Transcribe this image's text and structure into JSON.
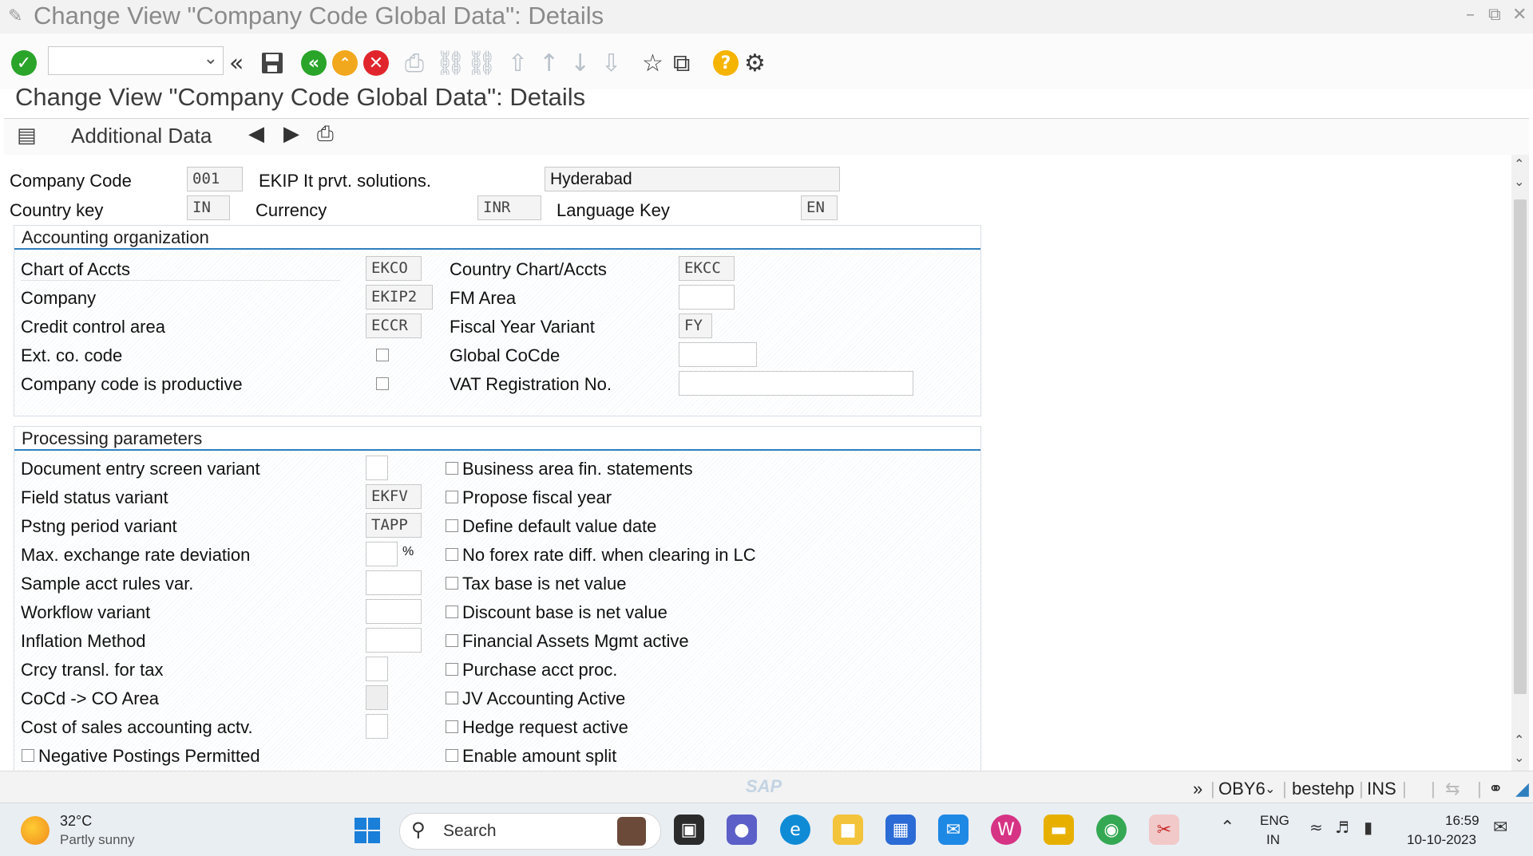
{
  "window": {
    "title": "Change View \"Company Code Global Data\": Details"
  },
  "toolbar": {
    "command_value": ""
  },
  "screen": {
    "title": "Change View \"Company Code Global Data\": Details"
  },
  "app_toolbar": {
    "additional_data_label": "Additional Data"
  },
  "header": {
    "company_code_label": "Company Code",
    "company_code_value": "001",
    "company_name": "EKIP It prvt. solutions.",
    "city": "Hyderabad",
    "country_key_label": "Country key",
    "country_key_value": "IN",
    "currency_label": "Currency",
    "currency_value": "INR",
    "language_key_label": "Language Key",
    "language_key_value": "EN"
  },
  "accounting_org": {
    "title": "Accounting organization",
    "chart_of_accts_label": "Chart of Accts",
    "chart_of_accts_value": "EKCO",
    "company_label": "Company",
    "company_value": "EKIP2",
    "credit_control_label": "Credit control area",
    "credit_control_value": "ECCR",
    "ext_co_code_label": "Ext. co. code",
    "productive_label": "Company code is productive",
    "country_chart_label": "Country Chart/Accts",
    "country_chart_value": "EKCC",
    "fm_area_label": "FM Area",
    "fm_area_value": "",
    "fiscal_year_label": "Fiscal Year Variant",
    "fiscal_year_value": "FY",
    "global_cocde_label": "Global CoCde",
    "global_cocde_value": "",
    "vat_label": "VAT Registration No.",
    "vat_value": ""
  },
  "processing": {
    "title": "Processing parameters",
    "doc_entry_label": "Document entry screen variant",
    "doc_entry_value": "",
    "field_status_label": "Field status variant",
    "field_status_value": "EKFV",
    "pstng_period_label": "Pstng period variant",
    "pstng_period_value": "TAPP",
    "max_exch_label": "Max. exchange rate deviation",
    "max_exch_value": "",
    "percent_sign": "%",
    "sample_acct_label": "Sample acct rules var.",
    "sample_acct_value": "",
    "workflow_label": "Workflow variant",
    "workflow_value": "",
    "inflation_label": "Inflation Method",
    "inflation_value": "",
    "crcy_transl_label": "Crcy transl. for tax",
    "crcy_transl_value": "",
    "cocd_co_label": "CoCd -> CO Area",
    "cocd_co_value": "",
    "cost_sales_label": "Cost of sales accounting actv.",
    "cost_sales_value": "",
    "negative_postings_label": "Negative Postings Permitted",
    "right_checks": [
      "Business area fin. statements",
      "Propose fiscal year",
      "Define default value date",
      "No forex rate diff. when clearing in LC",
      "Tax base is net value",
      "Discount base is net value",
      "Financial Assets Mgmt active",
      "Purchase acct proc.",
      "JV Accounting Active",
      "Hedge request active",
      "Enable amount split"
    ]
  },
  "statusbar": {
    "logo": "SAP",
    "transaction": "OBY6",
    "server": "bestehp",
    "mode": "INS"
  },
  "taskbar": {
    "weather_temp": "32°C",
    "weather_desc": "Partly sunny",
    "search_placeholder": "Search",
    "lang_line1": "ENG",
    "lang_line2": "IN",
    "time": "16:59",
    "date": "10-10-2023"
  },
  "colors": {
    "accent_blue": "#2f7fbf",
    "ok_green": "#2aa52a",
    "cancel_red": "#e0262c",
    "exit_orange": "#f2a81d",
    "help_yellow": "#f5b400"
  }
}
